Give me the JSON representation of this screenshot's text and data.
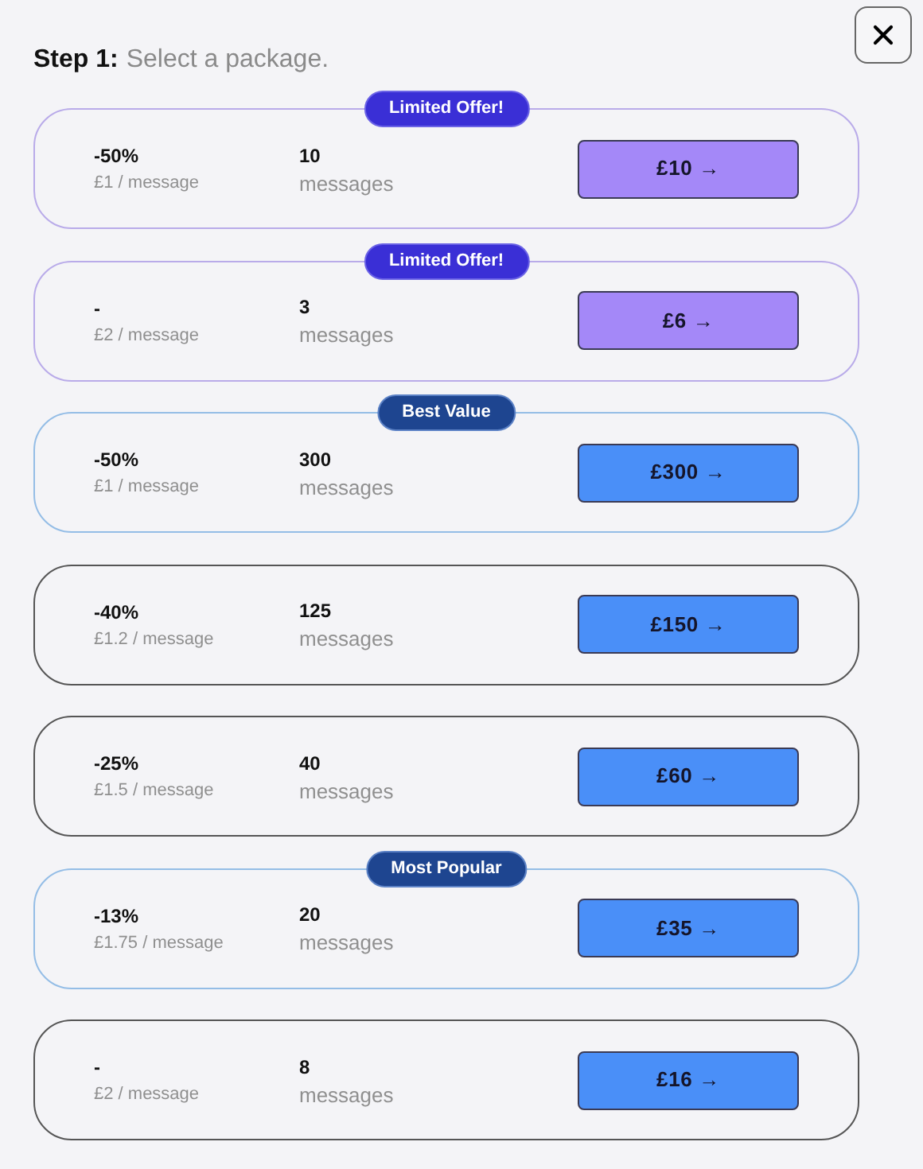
{
  "header": {
    "step": "Step 1:",
    "title": "Select a package."
  },
  "packages": [
    {
      "kind": "limited",
      "badge": "Limited Offer!",
      "discount": "-50%",
      "unit_price": "£1 / message",
      "count": "10",
      "count_label": "messages",
      "price": "£10 →"
    },
    {
      "kind": "limited",
      "badge": "Limited Offer!",
      "discount": "-",
      "unit_price": "£2 / message",
      "count": "3",
      "count_label": "messages",
      "price": "£6 →"
    },
    {
      "kind": "featured",
      "badge": "Best Value",
      "discount": "-50%",
      "unit_price": "£1 / message",
      "count": "300",
      "count_label": "messages",
      "price": "£300 →"
    },
    {
      "kind": "plain",
      "discount": "-40%",
      "unit_price": "£1.2 / message",
      "count": "125",
      "count_label": "messages",
      "price": "£150 →"
    },
    {
      "kind": "plain",
      "discount": "-25%",
      "unit_price": "£1.5 / message",
      "count": "40",
      "count_label": "messages",
      "price": "£60 →"
    },
    {
      "kind": "featured",
      "badge": "Most Popular",
      "discount": "-13%",
      "unit_price": "£1.75 / message",
      "count": "20",
      "count_label": "messages",
      "price": "£35 →"
    },
    {
      "kind": "plain",
      "discount": "-",
      "unit_price": "£2 / message",
      "count": "8",
      "count_label": "messages",
      "price": "£16 →"
    }
  ]
}
